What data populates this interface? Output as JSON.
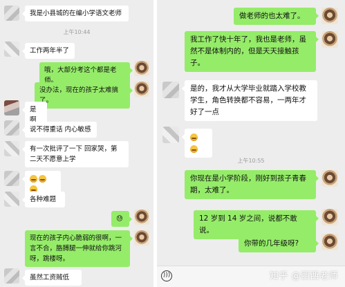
{
  "left_panel": {
    "messages": [
      {
        "side": "in",
        "text": "我是小县城的在编小学语文老师"
      },
      {
        "side": "time",
        "text": "上午10:44"
      },
      {
        "side": "in",
        "text": "工作两年半了"
      },
      {
        "side": "out",
        "text": "哦，大部分考这个都是老师。"
      },
      {
        "side": "out",
        "text": "没办法，现在的孩子太难搞了。"
      },
      {
        "side": "in",
        "text": "是啊"
      },
      {
        "side": "in",
        "text": "说不得重话 内心敏感"
      },
      {
        "side": "in",
        "text": "有一次批评了一下 回家哭，第二天不愿意上学"
      },
      {
        "side": "in",
        "text": "😂😂😂"
      },
      {
        "side": "in",
        "text": "各种难题"
      },
      {
        "side": "out",
        "text": "😓"
      },
      {
        "side": "out",
        "text": "现在的孩子内心脆弱的很啊，一言不合，胳膊腿一伸就给你跳河呀，跳楼呀。"
      },
      {
        "side": "in",
        "text": "虽然工资贼低"
      }
    ]
  },
  "right_panel": {
    "messages": [
      {
        "side": "out",
        "text": "做老师的也太难了。"
      },
      {
        "side": "out",
        "text": "我工作了快十年了，我也是老师，虽然不是体制内的，但是天天接触孩子。"
      },
      {
        "side": "in",
        "text": "是的，我才从大学毕业就踏入学校教学生，角色转换都不容易，一两年才好了一点"
      },
      {
        "side": "in",
        "text": "😂😂"
      },
      {
        "side": "time",
        "text": "上午10:55"
      },
      {
        "side": "out",
        "text": "你现在是小学阶段，刚好到孩子青春期，太难了。"
      },
      {
        "side": "out",
        "text": "12 岁到 14 岁之间，说都不敢说。"
      },
      {
        "side": "out",
        "text": "你带的几年级呀?"
      }
    ],
    "input_bar": {
      "voice_icon": "voice-icon"
    },
    "watermark": "知乎 @西西老师"
  }
}
